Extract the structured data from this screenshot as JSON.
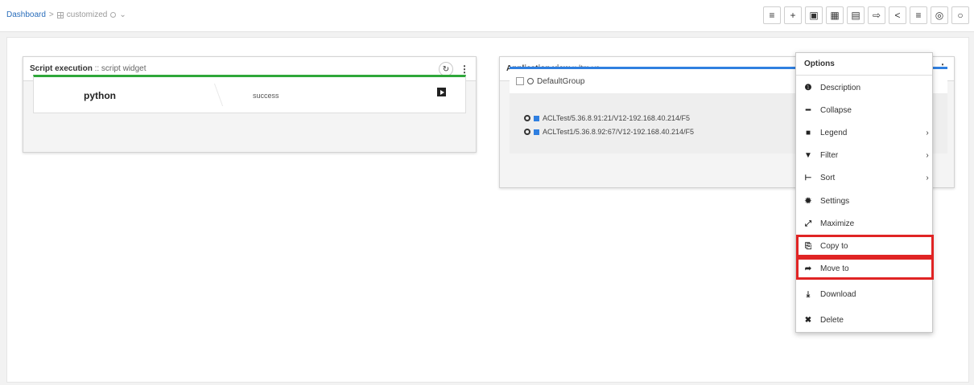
{
  "breadcrumb": {
    "root": "Dashboard",
    "separator": ">",
    "current": "customized",
    "dropdown": "⌄"
  },
  "toolbar": {
    "buttons": [
      {
        "icon": "list-icon",
        "glyph": "≡"
      },
      {
        "icon": "add-icon",
        "glyph": "+"
      },
      {
        "icon": "save-icon",
        "glyph": "▣"
      },
      {
        "icon": "save-as-icon",
        "glyph": "▦"
      },
      {
        "icon": "clipboard-icon",
        "glyph": "▤"
      },
      {
        "icon": "import-icon",
        "glyph": "⇨"
      },
      {
        "icon": "share-icon",
        "glyph": "<"
      },
      {
        "icon": "align-icon",
        "glyph": "≡"
      },
      {
        "icon": "target-icon",
        "glyph": "◎"
      },
      {
        "icon": "settings-icon",
        "glyph": "○"
      }
    ]
  },
  "script_widget": {
    "title_bold": "Script execution",
    "title_rest": " :: script widget",
    "refresh_glyph": "↻",
    "menu_glyph": "⋮",
    "script_name": "python",
    "status": "success",
    "status_color": "#2ea73a"
  },
  "app_widget": {
    "title_bold": "Application view",
    "title_rest": " :: ltm vs",
    "menu_glyph": "⋮",
    "group_name": "DefaultGroup",
    "items": [
      "ACLTest/5.36.8.91:21/V12-192.168.40.214/F5",
      "ACLTest1/5.36.8.92:67/V12-192.168.40.214/F5"
    ],
    "accent_color": "#2f7fe0"
  },
  "options_menu": {
    "header": "Options",
    "items": [
      {
        "label": "Description",
        "icon": "info-icon",
        "glyph": "❶",
        "submenu": false
      },
      {
        "label": "Collapse",
        "icon": "minus-icon",
        "glyph": "━",
        "submenu": false
      },
      {
        "label": "Legend",
        "icon": "legend-icon",
        "glyph": "■",
        "submenu": true
      },
      {
        "label": "Filter",
        "icon": "filter-icon",
        "glyph": "▼",
        "submenu": true
      },
      {
        "label": "Sort",
        "icon": "sort-icon",
        "glyph": "⊢",
        "submenu": true
      },
      {
        "label": "Settings",
        "icon": "gear-icon",
        "glyph": "✹",
        "submenu": false
      },
      {
        "label": "Maximize",
        "icon": "maximize-icon",
        "glyph": "⤢",
        "submenu": false
      },
      {
        "label": "Copy to",
        "icon": "copy-icon",
        "glyph": "⎘",
        "submenu": false,
        "highlighted": true
      },
      {
        "label": "Move to",
        "icon": "share-arrow-icon",
        "glyph": "➦",
        "submenu": false,
        "highlighted": true
      },
      {
        "label": "Download",
        "icon": "download-icon",
        "glyph": "⤓",
        "submenu": false
      },
      {
        "label": "Delete",
        "icon": "delete-icon",
        "glyph": "✖",
        "submenu": false
      }
    ],
    "highlight_color": "#e02424",
    "chevron": "›"
  }
}
